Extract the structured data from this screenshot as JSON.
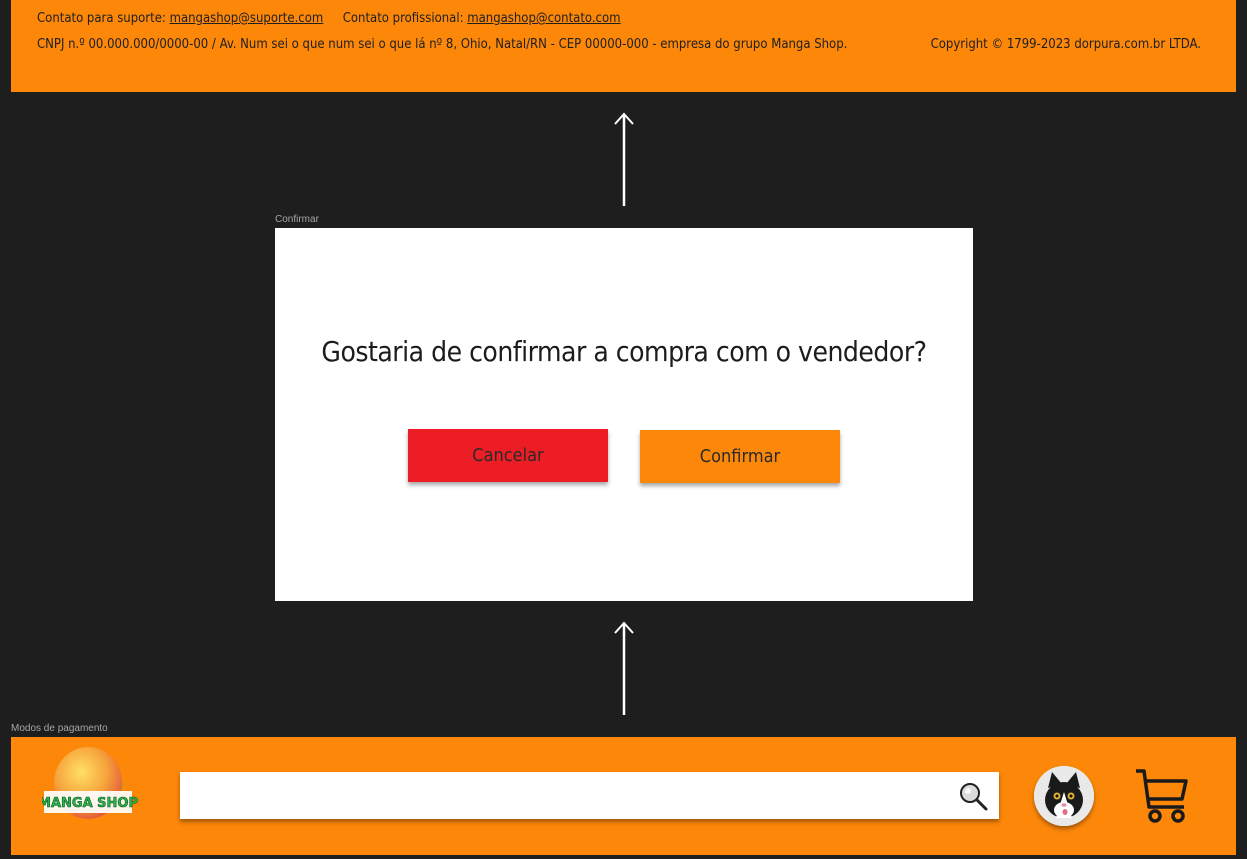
{
  "footer": {
    "support_label": "Contato para suporte:",
    "support_email": "mangashop@suporte.com",
    "pro_label": "Contato profissional:",
    "pro_email": "mangashop@contato.com",
    "address": "CNPJ n.º 00.000.000/0000-00 / Av. Num sei o que num sei o que lá nº 8, Ohio, Natal/RN - CEP 00000-000 - empresa do grupo Manga Shop.",
    "copyright": "Copyright © 1799-2023 dorpura.com.br LTDA."
  },
  "frames": {
    "confirm_label": "Confirmar",
    "payment_label": "Modos de pagamento"
  },
  "modal": {
    "question": "Gostaria de confirmar a compra com o vendedor?",
    "cancel_label": "Cancelar",
    "confirm_label": "Confirmar"
  },
  "header": {
    "logo_text": "MANGA SHOP",
    "search_value": "",
    "icons": {
      "search": "magnifier-icon",
      "avatar": "cat-avatar",
      "cart": "shopping-cart-icon"
    }
  },
  "colors": {
    "background": "#1e1e1e",
    "accent": "#fc8709",
    "cancel": "#ed1d25",
    "modal": "#ffffff"
  }
}
